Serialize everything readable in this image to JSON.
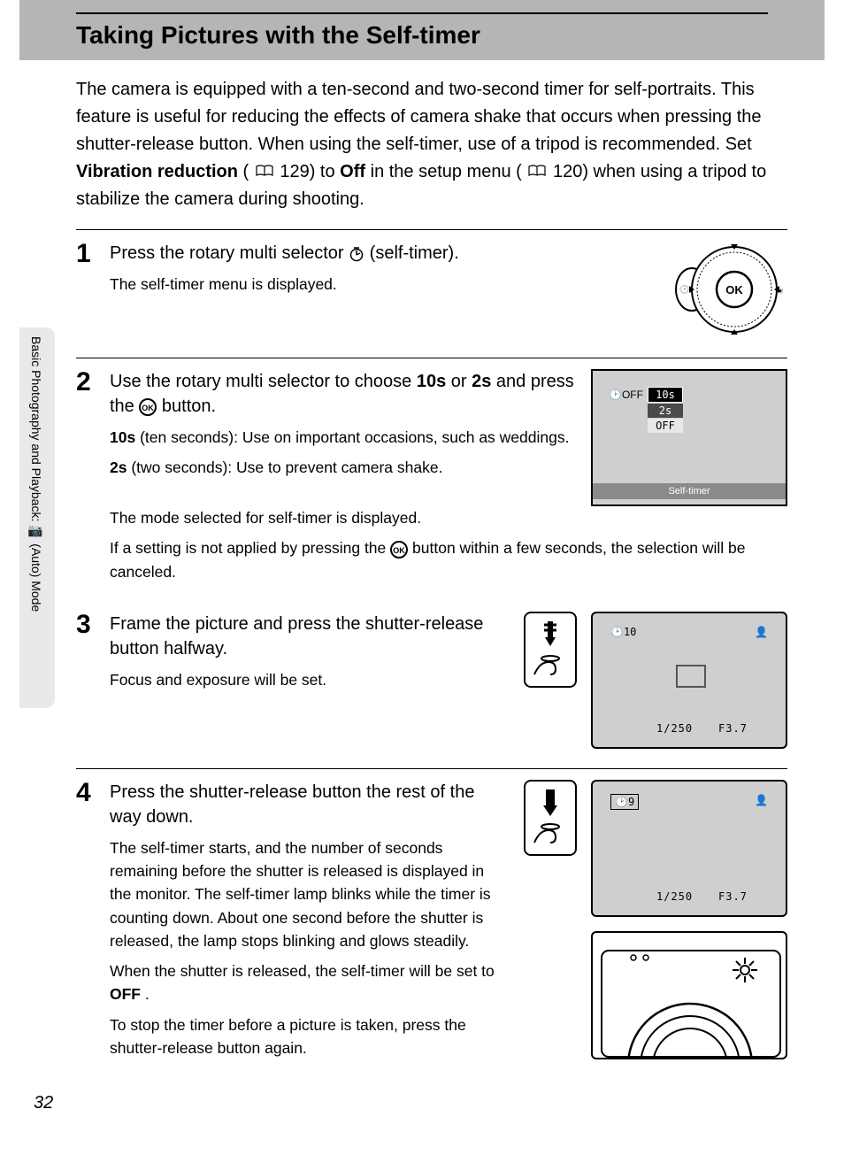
{
  "header": {
    "title": "Taking Pictures with the Self-timer"
  },
  "sidebar": {
    "label": "Basic Photography and Playback: 📷 (Auto) Mode"
  },
  "intro": {
    "p1a": "The camera is equipped with a ten-second and two-second timer for self-portraits. This feature is useful for reducing the effects of camera shake that occurs when pressing the shutter-release button. When using the self-timer, use of a tripod is recommended. Set ",
    "bold1": "Vibration reduction",
    "p1b": " (",
    "ref1": " 129) to ",
    "bold2": "Off",
    "p1c": " in the setup menu (",
    "ref2": " 120) when using a tripod to stabilize the camera during shooting."
  },
  "steps": {
    "s1": {
      "num": "1",
      "head_a": "Press the rotary multi selector ",
      "head_b": " (self-timer).",
      "desc": "The self-timer menu is displayed.",
      "dial_label": "OK"
    },
    "s2": {
      "num": "2",
      "head_a": "Use the rotary multi selector to choose ",
      "b1": "10s",
      "head_b": " or ",
      "b2": "2s",
      "head_c": " and press the ",
      "head_d": " button.",
      "desc1a_b": "10s",
      "desc1a": " (ten seconds): Use on important occasions, such as weddings.",
      "desc2a_b": "2s",
      "desc2a": " (two seconds): Use to prevent camera shake.",
      "desc3": "The mode selected for self-timer is displayed.",
      "desc4a": "If a setting is not applied by pressing the ",
      "desc4b": " button within a few seconds, the selection will be canceled.",
      "menu": {
        "opt1": "10s",
        "opt2": "2s",
        "opt3": "OFF",
        "footer": "Self-timer",
        "off_indicator": "🕑OFF"
      }
    },
    "s3": {
      "num": "3",
      "head": "Frame the picture and press the shutter-release button halfway.",
      "desc": "Focus and exposure will be set.",
      "lcd": {
        "tl": "🕑10",
        "tr": "👤",
        "shutter": "1/250",
        "fstop": "F3.7"
      }
    },
    "s4": {
      "num": "4",
      "head": "Press the shutter-release button the rest of the way down.",
      "desc1": "The self-timer starts, and the number of seconds remaining before the shutter is released is displayed in the monitor. The self-timer lamp blinks while the timer is counting down. About one second before the shutter is released, the lamp stops blinking and glows steadily.",
      "desc2a": "When the shutter is released, the self-timer will be set to ",
      "desc2b": "OFF",
      "desc2c": ".",
      "desc3": "To stop the timer before a picture is taken, press the shutter-release button again.",
      "lcd": {
        "tl": "🕑9",
        "tr": "👤",
        "shutter": "1/250",
        "fstop": "F3.7"
      }
    }
  },
  "page_number": "32"
}
